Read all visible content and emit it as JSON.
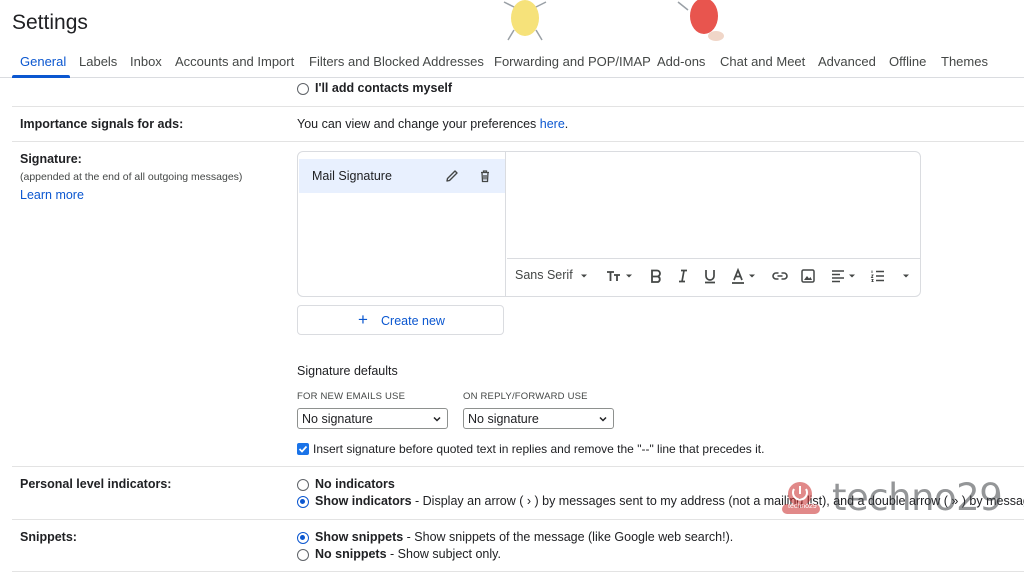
{
  "page_title": "Settings",
  "tabs": [
    {
      "label": "General",
      "active": true
    },
    {
      "label": "Labels"
    },
    {
      "label": "Inbox"
    },
    {
      "label": "Accounts and Import"
    },
    {
      "label": "Filters and Blocked Addresses"
    },
    {
      "label": "Forwarding and POP/IMAP"
    },
    {
      "label": "Add-ons"
    },
    {
      "label": "Chat and Meet"
    },
    {
      "label": "Advanced"
    },
    {
      "label": "Offline"
    },
    {
      "label": "Themes"
    }
  ],
  "contacts": {
    "option_label": "I'll add contacts myself"
  },
  "importance_ads": {
    "label": "Importance signals for ads:",
    "text": "You can view and change your preferences ",
    "link": "here",
    "after": "."
  },
  "signature": {
    "label": "Signature:",
    "sublabel": "(appended at the end of all outgoing messages)",
    "learn_more": "Learn more",
    "items": [
      {
        "name": "Mail Signature",
        "selected": true
      }
    ],
    "toolbar": {
      "font": "Sans Serif"
    },
    "create_new": "Create new",
    "defaults": {
      "title": "Signature defaults",
      "new_caption": "FOR NEW EMAILS USE",
      "new_value": "No signature",
      "reply_caption": "ON REPLY/FORWARD USE",
      "reply_value": "No signature",
      "insert_checkbox": {
        "checked": true,
        "label": "Insert signature before quoted text in replies and remove the \"--\" line that precedes it."
      }
    }
  },
  "personal_level": {
    "label": "Personal level indicators:",
    "options": [
      {
        "title": "No indicators",
        "desc": "",
        "selected": false
      },
      {
        "title": "Show indicators",
        "desc": " - Display an arrow ( › ) by messages sent to my address (not a mailing list), and a double arrow ( » ) by messages",
        "selected": true
      }
    ]
  },
  "snippets": {
    "label": "Snippets:",
    "options": [
      {
        "title": "Show snippets",
        "desc": " - Show snippets of the message (like Google web search!).",
        "selected": true
      },
      {
        "title": "No snippets",
        "desc": " - Show subject only.",
        "selected": false
      }
    ]
  },
  "watermark": {
    "text": "techno29",
    "badge": "techno29"
  },
  "colors": {
    "accent": "#0b57d0",
    "selected_bg": "#e8f0fe",
    "divider": "#e3e3e3"
  },
  "icons": [
    "pencil-icon",
    "trash-icon",
    "text-size-icon",
    "bold-icon",
    "italic-icon",
    "underline-icon",
    "text-color-icon",
    "link-icon",
    "image-icon",
    "align-icon",
    "numbered-list-icon",
    "more-icon",
    "plus-icon",
    "chevron-down-icon",
    "check-icon"
  ]
}
